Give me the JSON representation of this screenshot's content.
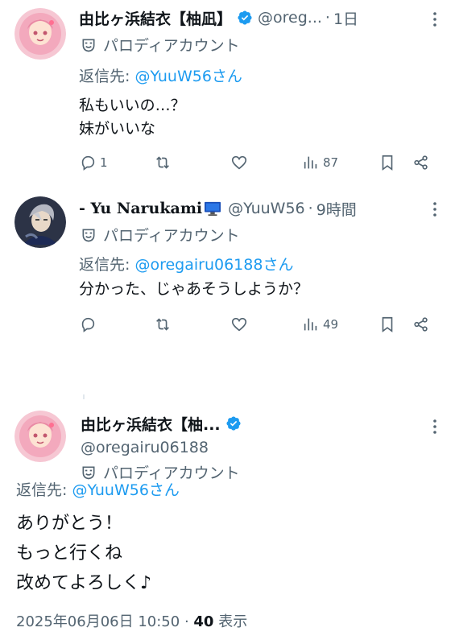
{
  "tweets": [
    {
      "display_name": "由比ヶ浜結衣【柚凪】",
      "handle": "@oreg...",
      "time": "1日",
      "label": "パロディアカウント",
      "reply_prefix": "返信先: ",
      "reply_to": "@YuuW56さん",
      "text": "私もいいの…？\n妹がいいな",
      "stats": {
        "replies": "1",
        "retweets": "",
        "likes": "",
        "views": "87"
      }
    },
    {
      "display_name": "- Yu Narukami",
      "handle": "@YuuW56",
      "time": "9時間",
      "label": "パロディアカウント",
      "reply_prefix": "返信先: ",
      "reply_to": "@oregairu06188さん",
      "text": "分かった、じゃあそうしようか？",
      "stats": {
        "replies": "",
        "retweets": "",
        "likes": "",
        "views": "49"
      }
    }
  ],
  "focused": {
    "display_name": "由比ヶ浜結衣【柚...",
    "handle": "@oregairu06188",
    "label": "パロディアカウント",
    "reply_prefix": "返信先: ",
    "reply_to": "@YuuW56さん",
    "text": "ありがとう！\nもっと行くね\n改めてよろしく♪",
    "timestamp": "2025年06月06日 10:50",
    "views_count": "40",
    "views_label": "表示"
  },
  "colors": {
    "accent": "#1d9bf0",
    "muted": "#536471",
    "text": "#0f1419"
  },
  "icons": [
    "verified-badge-icon",
    "parody-mask-icon",
    "more-icon",
    "reply-icon",
    "retweet-icon",
    "like-icon",
    "views-icon",
    "bookmark-icon",
    "share-icon",
    "monitor-icon"
  ]
}
